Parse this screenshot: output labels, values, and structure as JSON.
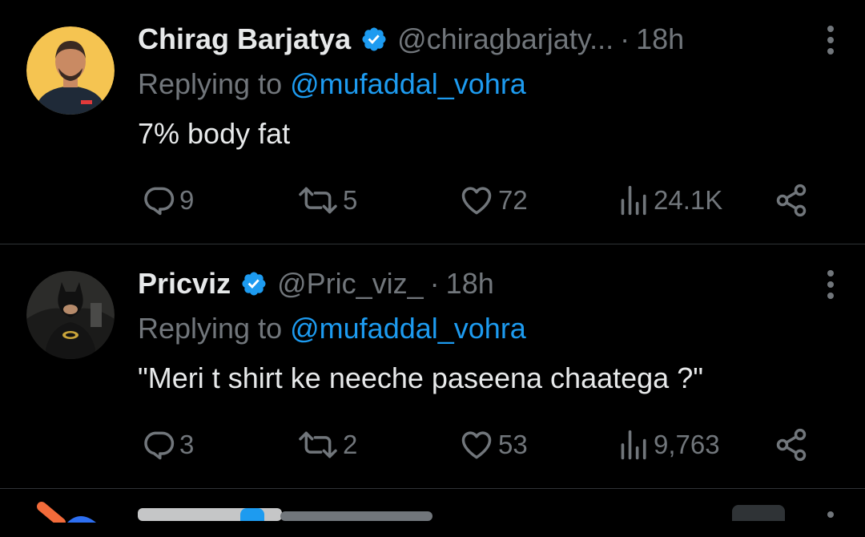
{
  "tweets": [
    {
      "name": "Chirag Barjatya",
      "handle": "@chiragbarjaty...",
      "separator": "·",
      "time": "18h",
      "replying_prefix": "Replying to ",
      "replying_to": "@mufaddal_vohra",
      "text": "7% body fat",
      "replies": "9",
      "retweets": "5",
      "likes": "72",
      "views": "24.1K",
      "avatar_bg": "#f5c451"
    },
    {
      "name": "Pricviz",
      "handle": "@Pric_viz_",
      "separator": "·",
      "time": "18h",
      "replying_prefix": "Replying to ",
      "replying_to": "@mufaddal_vohra",
      "text": "\"Meri t shirt ke neeche paseena chaatega ?\"",
      "replies": "3",
      "retweets": "2",
      "likes": "53",
      "views": "9,763",
      "avatar_bg": "#3a3a3a"
    }
  ],
  "colors": {
    "background": "#000000",
    "text": "#e7e9ea",
    "muted": "#71767b",
    "accent": "#1d9bf0",
    "divider": "#2f3336"
  },
  "icons": {
    "reply": "reply-icon",
    "retweet": "retweet-icon",
    "like": "heart-icon",
    "views": "views-icon",
    "share": "share-icon",
    "more": "more-vertical-icon",
    "verified": "verified-badge-icon"
  }
}
